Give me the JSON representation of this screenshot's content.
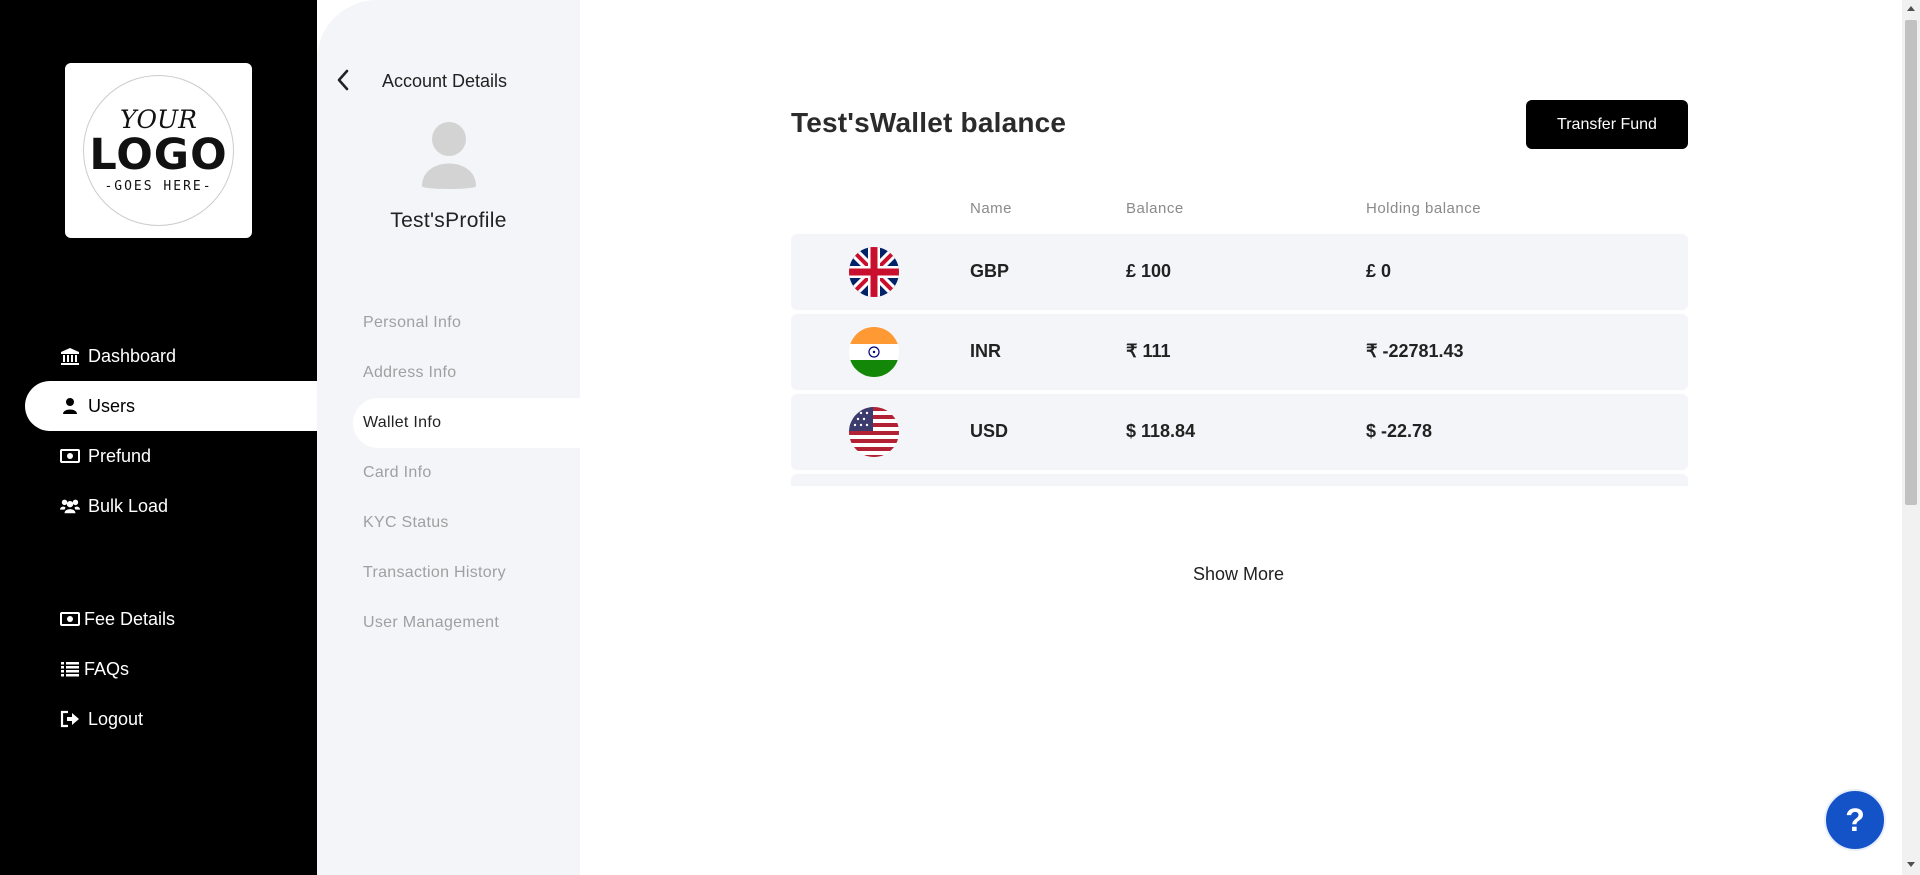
{
  "logo": {
    "line1": "YOUR",
    "line2": "LOGO",
    "line3": "-GOES HERE-"
  },
  "nav": {
    "items": [
      {
        "label": "Dashboard",
        "icon": "bank-icon"
      },
      {
        "label": "Users",
        "icon": "user-icon",
        "active": true
      },
      {
        "label": "Prefund",
        "icon": "money-icon"
      },
      {
        "label": "Bulk Load",
        "icon": "users-icon"
      }
    ],
    "bottom_items": [
      {
        "label": "Fee Details",
        "icon": "money-icon"
      },
      {
        "label": "FAQs",
        "icon": "list-icon"
      },
      {
        "label": "Logout",
        "icon": "logout-icon"
      }
    ]
  },
  "account": {
    "title": "Account Details",
    "profile_name": "Test'sProfile",
    "menu": [
      "Personal Info",
      "Address Info",
      "Wallet Info",
      "Card Info",
      "KYC Status",
      "Transaction History",
      "User Management"
    ],
    "active_menu": "Wallet Info"
  },
  "wallet": {
    "title": "Test'sWallet balance",
    "transfer_label": "Transfer Fund",
    "columns": {
      "name": "Name",
      "balance": "Balance",
      "holding": "Holding balance"
    },
    "rows": [
      {
        "flag": "uk-flag-icon",
        "name": "GBP",
        "balance": "£ 100",
        "holding": "£ 0"
      },
      {
        "flag": "india-flag-icon",
        "name": "INR",
        "balance": "₹ 111",
        "holding": "₹ -22781.43"
      },
      {
        "flag": "us-flag-icon",
        "name": "USD",
        "balance": "$ 118.84",
        "holding": "$ -22.78"
      }
    ],
    "show_more": "Show More"
  },
  "help": {
    "label": "?"
  },
  "colors": {
    "sidebar": "#000000",
    "panel": "#f4f5f8",
    "row": "#f4f5f8",
    "help": "#1452c7"
  }
}
